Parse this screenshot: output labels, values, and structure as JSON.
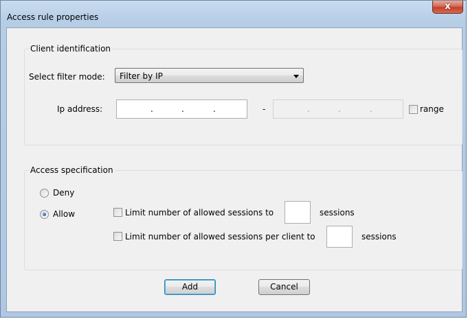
{
  "window": {
    "title": "Access rule properties",
    "close_label": "x"
  },
  "client_identification": {
    "group_label": "Client identification",
    "filter_mode_label": "Select filter mode:",
    "filter_mode_value": "Filter by IP",
    "ip_label": "Ip address:",
    "ip_separator": "-",
    "ip_dot": ".",
    "range_label": "range",
    "range_checked": false
  },
  "access_specification": {
    "group_label": "Access specification",
    "deny_label": "Deny",
    "allow_label": "Allow",
    "selected": "Allow",
    "limit_sessions_label": "Limit number of allowed sessions to",
    "limit_sessions_unit": "sessions",
    "limit_sessions_checked": false,
    "limit_per_client_label": "Limit number of allowed sessions per client to",
    "limit_per_client_unit": "sessions",
    "limit_per_client_checked": false
  },
  "buttons": {
    "add": "Add",
    "cancel": "Cancel"
  }
}
